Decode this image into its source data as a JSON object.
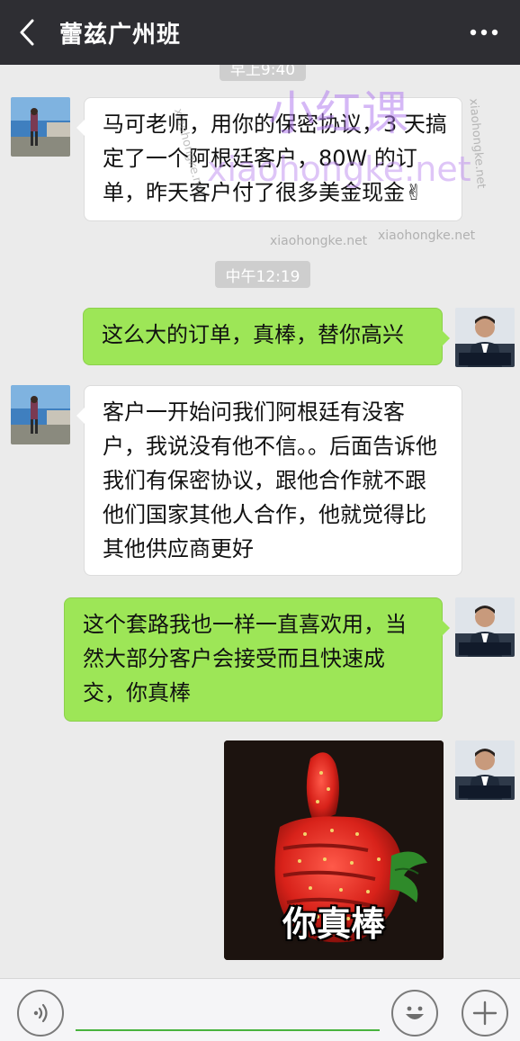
{
  "header": {
    "title": "蕾兹广州班"
  },
  "chat": {
    "time_top": "早上9:40",
    "time_mid": "中午12:19",
    "messages": [
      {
        "from": "other",
        "text": "马可老师，用你的保密协议，3 天搞定了一个阿根廷客户，80W 的订单，昨天客户付了很多美金现金✌"
      },
      {
        "from": "me",
        "text": "这么大的订单，真棒，替你高兴"
      },
      {
        "from": "other",
        "text": "客户一开始问我们阿根廷有没客户，我说没有他不信。。后面告诉他我们有保密协议，跟他合作就不跟他们国家其他人合作，他就觉得比其他供应商更好"
      },
      {
        "from": "me",
        "text": "这个套路我也一样一直喜欢用，当然大部分客户会接受而且快速成交，你真棒"
      }
    ],
    "sticker_caption": "你真棒"
  },
  "watermark": {
    "big_cn": "小红课",
    "big_en": "xiaohongke.net",
    "small": "xiaohongke.net"
  },
  "icons": {
    "back": "chevron-left-icon",
    "more": "more-dots-icon",
    "voice": "voice-icon",
    "emoji": "emoji-icon",
    "plus": "plus-icon"
  },
  "colors": {
    "topbar": "#2e2e33",
    "out_bubble": "#9de657",
    "in_bubble": "#ffffff",
    "background": "#ebebeb",
    "input_underline": "#48b33e"
  }
}
